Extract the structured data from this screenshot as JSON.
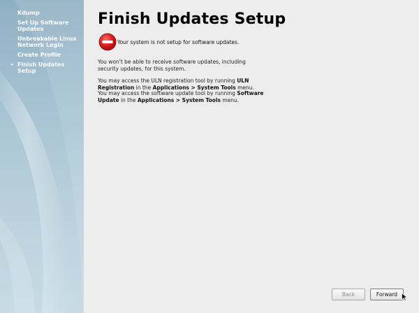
{
  "sidebar": {
    "steps": [
      {
        "label": "Kdump",
        "current": false
      },
      {
        "label": "Set Up Software Updates",
        "current": false
      },
      {
        "label": "Unbreakable Linux Network Login",
        "current": false
      },
      {
        "label": "Create Profile",
        "current": false
      },
      {
        "label": "Finish Updates Setup",
        "current": true
      }
    ],
    "current_marker": "▸"
  },
  "page": {
    "title": "Finish Updates Setup",
    "status_icon": "stop-icon",
    "status_text": "Your system is not setup for software updates.",
    "para1": "You won't be able to receive software updates, including security updates, for this system.",
    "para2_pre": "You may access the ULN registration tool by running ",
    "para2_bold1": "ULN Registration",
    "para2_mid": " in the ",
    "para2_bold2": "Applications > System Tools",
    "para2_post": " menu.",
    "para3_pre": "You may access the software update tool by running ",
    "para3_bold1": "Software Update",
    "para3_mid": " in the ",
    "para3_bold2": "Applications > System Tools",
    "para3_post": " menu."
  },
  "buttons": {
    "back_label": "Back",
    "forward_label": "Forward"
  },
  "colors": {
    "sidebar_top": "#8fb0c3",
    "sidebar_bottom": "#c8dbe5",
    "background": "#ededed",
    "stop_red": "#d41a1a"
  }
}
